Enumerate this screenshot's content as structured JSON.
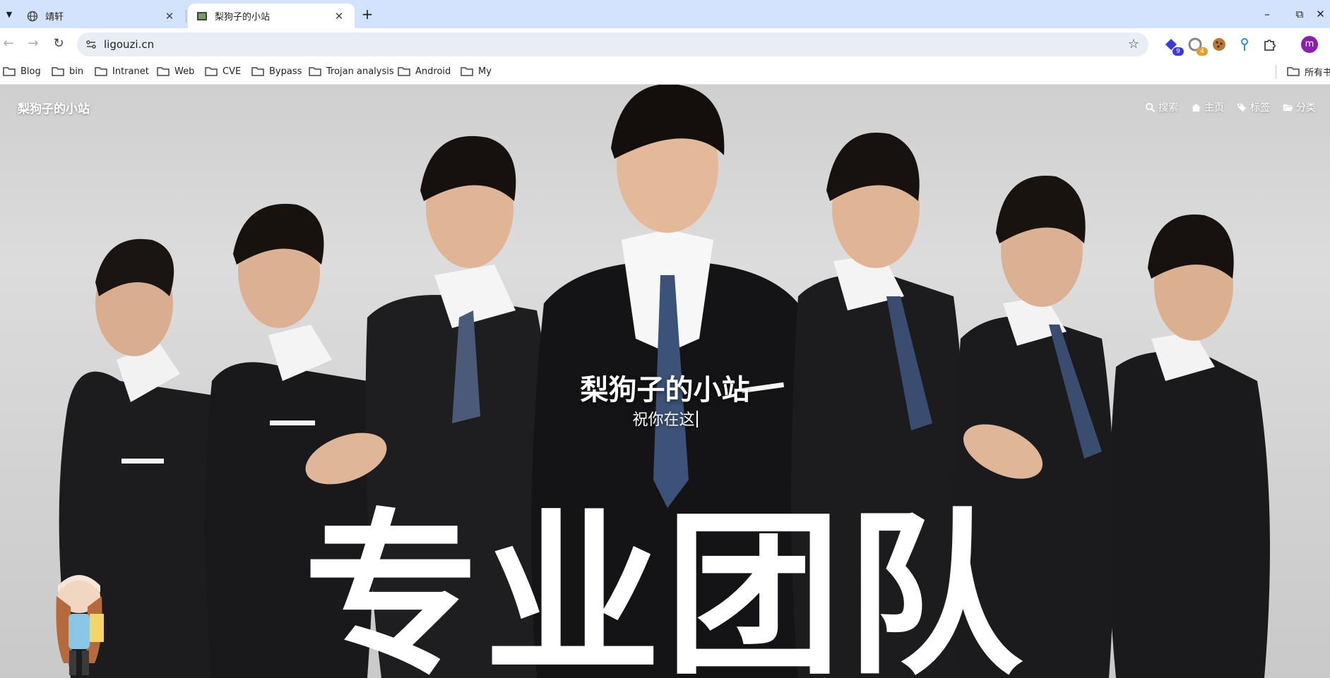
{
  "browser": {
    "tabs": [
      {
        "title": "靖轩",
        "active": false,
        "favicon": "globe-icon"
      },
      {
        "title": "梨狗子的小站",
        "active": true,
        "favicon": "site-favicon"
      }
    ],
    "new_tab_label": "+",
    "window_controls": {
      "minimize": "–",
      "restore": "⧉",
      "close": "✕"
    },
    "address": {
      "url": "ligouzi.cn"
    },
    "extensions": [
      {
        "icon": "extension-badge-9-icon",
        "badge": "9",
        "color": "#3b3bd9"
      },
      {
        "icon": "extension-badge-4-icon",
        "badge": "4",
        "color": "#e0a02a"
      },
      {
        "icon": "cookie-icon"
      },
      {
        "icon": "pin-icon"
      },
      {
        "icon": "puzzle-icon"
      }
    ],
    "profile_initial": "m",
    "bookmarks": [
      "Blog",
      "bin",
      "Intranet",
      "Web",
      "CVE",
      "Bypass",
      "Trojan analysis",
      "Android",
      "My"
    ],
    "all_bookmarks_label": "所有书"
  },
  "site": {
    "logo_text": "梨狗子的小站",
    "nav": [
      {
        "icon": "search-icon",
        "label": "搜索"
      },
      {
        "icon": "home-icon",
        "label": "主页"
      },
      {
        "icon": "tags-icon",
        "label": "标签"
      },
      {
        "icon": "folder-open-icon",
        "label": "分类"
      }
    ],
    "hero_title": "梨狗子的小站",
    "hero_subtitle": "祝你在这",
    "banner_text": "专业团队"
  }
}
